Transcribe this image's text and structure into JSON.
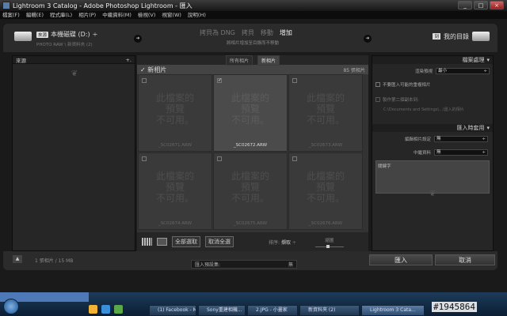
{
  "window": {
    "title": "Lightroom 3 Catalog - Adobe Photoshop Lightroom - 匯入",
    "minimize": "_",
    "maximize": "□",
    "close": "×"
  },
  "menu": [
    "檔案(F)",
    "編輯(E)",
    "程式庫(L)",
    "相片(P)",
    "中繼資料(M)",
    "檢視(V)",
    "視窗(W)",
    "說明(H)"
  ],
  "header": {
    "source_badge": "來源",
    "source_name": "本機磁碟 (D:)",
    "source_arrow": "÷",
    "source_sub": "PHOTO RAW \\ 新資料夾 (2)",
    "modes": [
      "拷貝為 DNG",
      "拷貝",
      "移動",
      "增加"
    ],
    "active_mode": "增加",
    "mode_desc": "將相片增加至目錄而不移動",
    "dest_badge": "到",
    "dest_name": "我的目錄"
  },
  "left_panel": {
    "title": "來源",
    "toggle": "+."
  },
  "grid": {
    "tabs": [
      "所有相片",
      "新相片"
    ],
    "active_tab": "新相片",
    "section_title": "新相片",
    "count_label": "85 張相片",
    "cells": [
      {
        "preview": "此檔案的\n預覽\n不可用。",
        "filename": "_SC02671.ARW",
        "checked": false,
        "selected": false
      },
      {
        "preview": "此檔案的\n預覽\n不可用。",
        "filename": "_SC02672.ARW",
        "checked": true,
        "selected": true
      },
      {
        "preview": "此檔案的\n預覽\n不可用。",
        "filename": "_SC02673.ARW",
        "checked": false,
        "selected": false
      },
      {
        "preview": "此檔案的\n預覽\n不可用。",
        "filename": "_SC02674.ARW",
        "checked": false,
        "selected": false
      },
      {
        "preview": "此檔案的\n預覽\n不可用。",
        "filename": "_SC02675.ARW",
        "checked": false,
        "selected": false
      },
      {
        "preview": "此檔案的\n預覽\n不可用。",
        "filename": "_SC02676.ARW",
        "checked": false,
        "selected": false
      }
    ],
    "check_all": "全部選取",
    "uncheck_all": "取消全選",
    "sort_label": "排序:",
    "sort_value": "擷取",
    "sort_arrow": "÷",
    "thumb_label": "縮圖"
  },
  "right_panel": {
    "file_handling_title": "檔案處理",
    "render_previews_label": "渲染預視",
    "render_previews_value": "最小",
    "dont_import_dupes": "不要匯入可能的重複相片",
    "second_copy": "製作第二個副本到:",
    "second_copy_path": "C:\\Documents and Settings\\...\\匯入的相片",
    "apply_title": "匯入時套用",
    "develop_label": "編輯相片設定",
    "develop_value": "無",
    "metadata_label": "中繼資料",
    "metadata_value": "無",
    "keywords_label": "關鍵字",
    "toggle": "▾"
  },
  "footer": {
    "files_info": "1 張相片 / 15 MB",
    "preset_label": "匯入預設集:",
    "preset_value": "無",
    "import_button": "匯入",
    "cancel_button": "取消"
  },
  "taskbar": {
    "items": [
      "(1) Facebook - M...",
      "Sony重建相機...",
      "2.JPG - 小畫家",
      "新資料夾 (2)",
      "Lightroom 3 Cata..."
    ],
    "watermark": "#1945864"
  }
}
